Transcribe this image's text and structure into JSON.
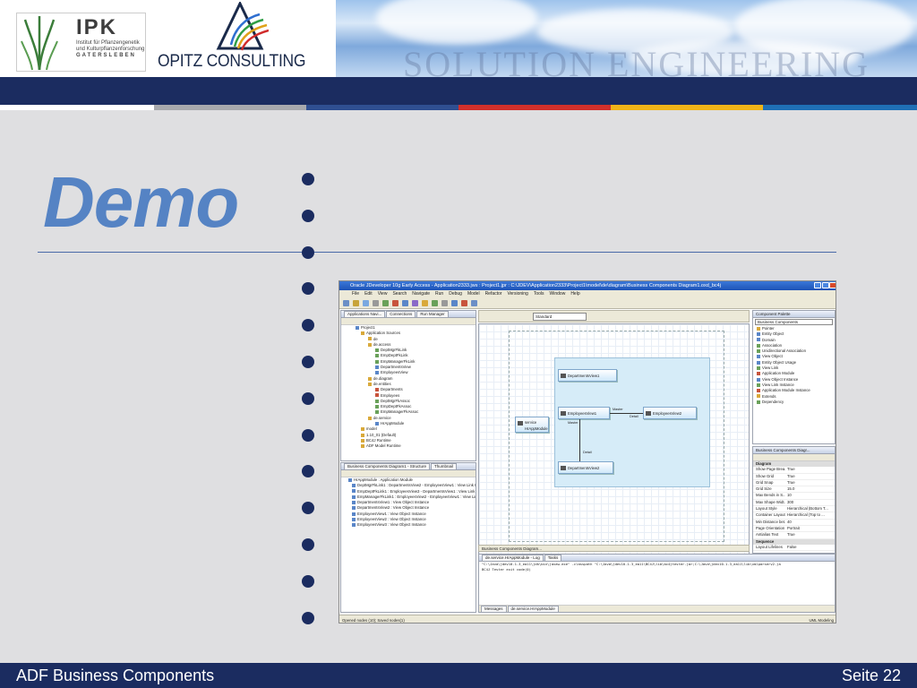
{
  "header": {
    "ipk_name": "IPK",
    "ipk_subtitle_1": "Institut für Pflanzengenetik",
    "ipk_subtitle_2": "und Kulturpflanzenforschung",
    "ipk_subtitle_3": "GATERSLEBEN",
    "opitz_name": "OPITZ CONSULTING",
    "watermark": "SOLUTION ENGINEERING",
    "stripe_colors": [
      "#ffffff",
      "#a8a9ad",
      "#2f4f91",
      "#d2302b",
      "#f0b418",
      "#1f6fb5"
    ]
  },
  "title": "Demo",
  "bullet_count": 13,
  "screenshot": {
    "window_title": "Oracle JDeveloper 10g Early Access - Application2333.jws : Project1.jpr : C:\\JDEV\\Application2333\\Project1\\model\\de\\diagram\\Business Components Diagram1.oxd_bc4j",
    "menu": [
      "File",
      "Edit",
      "View",
      "Search",
      "Navigate",
      "Run",
      "Debug",
      "Model",
      "Refactor",
      "Versioning",
      "Tools",
      "Window",
      "Help"
    ],
    "navigator": {
      "tabs": [
        "Applications Navi...",
        "Connections",
        "Run Manager"
      ],
      "items": [
        "Project1",
        "Application Sources",
        "de",
        "de.access",
        "DeptMgrFkLink",
        "EmpDeptFkLink",
        "EmpManagerFkLink",
        "DepartmentsView",
        "EmployeesView",
        "de.diagram",
        "de.entities",
        "Departments",
        "Employees",
        "DeptMgrFkAssoc",
        "EmpDeptFkAssoc",
        "EmpManagerFkAssoc",
        "de.service",
        "HrAppModule",
        "model",
        "1.10_01 (Default)",
        "BC4J Runtime",
        "ADF Model Runtime"
      ]
    },
    "structure": {
      "tabs": [
        "Business Components Diagram1 - Structure",
        "Thumbnail"
      ],
      "items": [
        "HrAppModule : Application Module",
        "DeptMgrFkLink1 : DepartmentsView2 - EmployeesView1 : View Link Ins",
        "EmpDeptFkLink1 : EmployeesView3 - DepartmentsView1 : View Link Ins",
        "EmpManagerFkLink1 : EmployeesView2 - EmployeesView1 : View Link",
        "DepartmentsView1 : View Object Instance",
        "DepartmentsView2 : View Object Instance",
        "EmployeesView1 : View Object Instance",
        "EmployeesView2 : View Object Instance",
        "EmployeesView3 : View Object Instance"
      ]
    },
    "diagram": {
      "dropdown": "Standard",
      "nodes": [
        "DepartmentsView1",
        "EmployeesView1",
        "EmployeesView2",
        "DepartmentsView2",
        "service",
        "HrAppModule"
      ],
      "labels": [
        "Master",
        "Detail",
        "Master",
        "Detail"
      ],
      "tab": "Business Components Diagram..."
    },
    "palette": {
      "header": "Component Palette",
      "dropdown": "Business Components",
      "items": [
        "Pointer",
        "Entity Object",
        "Domain",
        "Association",
        "Unidirectional Association",
        "View Object",
        "Entity Object Usage",
        "View Link",
        "Application Module",
        "View Object Instance",
        "View Link Instance",
        "Application Module Instance",
        "Extends",
        "Dependency"
      ]
    },
    "inspector": {
      "header": "Business Components Diagr...",
      "section": "Diagram",
      "rows": [
        [
          "Show Page Brea...",
          "True"
        ],
        [
          "Show Grid",
          "True"
        ],
        [
          "Grid Snap",
          "True"
        ],
        [
          "Grid Size",
          "15.0"
        ],
        [
          "Max Bends in S...",
          "10"
        ],
        [
          "Max Shape Widt...",
          "300"
        ],
        [
          "Layout Style",
          "Hierarchical (Bottom T..."
        ],
        [
          "Container Layout",
          "Hierarchical (Top to ..."
        ],
        [
          "Min Distance bet...",
          "40"
        ],
        [
          "Page Orientation",
          "Portrait"
        ],
        [
          "Antialias Text",
          "True"
        ]
      ],
      "section2": "Sequence",
      "rows2": [
        [
          "Layout Lifelines",
          "False"
        ]
      ]
    },
    "log": {
      "tabs": [
        "de.service.HrAppModule - Log",
        "Tasks"
      ],
      "line1": "\"C:\\Java\\jdev10.1.3_ea11\\jdk\\bin\\javaw.exe\" -classpath \"C:\\Java\\jdev10.1.3_ea11\\BC4J\\lib\\bc4jtester.jar;C:\\Java\\jdev10.1.3_ea11\\lib\\xmlparserv2.ja",
      "line2": "BC4J Tester exit code(0)",
      "bottom_tabs": [
        "Messages",
        "de.service.HrAppModule"
      ]
    },
    "status": "Opened nodes (10); Saved nodes(1)",
    "status_right": "UML Modeling"
  },
  "footer": {
    "left": "ADF Business Components",
    "right": "Seite 22"
  }
}
